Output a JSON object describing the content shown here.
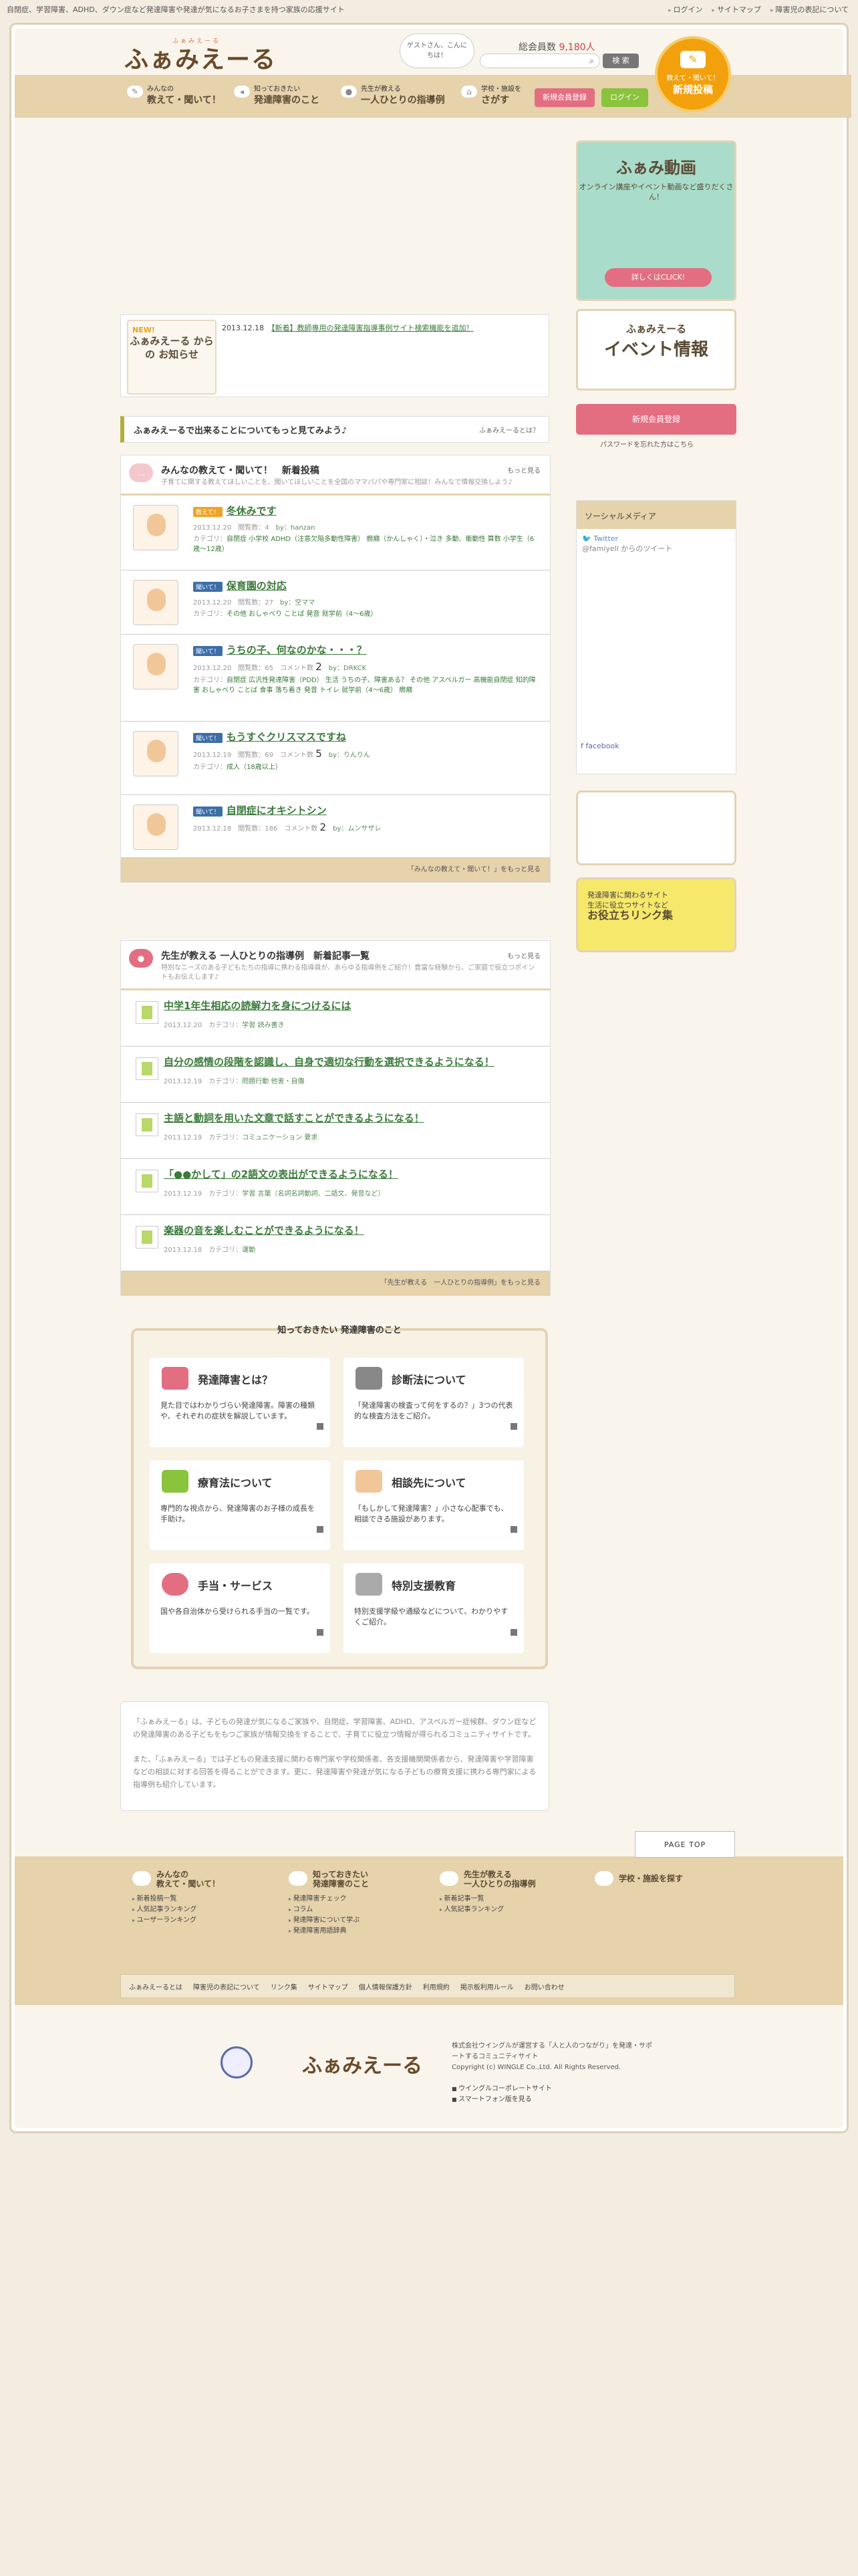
{
  "topbar": {
    "description": "自閉症、学習障害、ADHD、ダウン症など発達障害や発達が気になるお子さまを持つ家族の応援サイト",
    "links": [
      "ログイン",
      "サイトマップ",
      "障害児の表記について"
    ]
  },
  "header": {
    "logo": "ふぁみえーる",
    "logo_kana": "ふぁみえーる",
    "guest_text": "ゲストさん、こんにちは！",
    "member_label": "総会員数",
    "member_count": "9,180人",
    "search_button": "検 索",
    "newpost_small": "教えて・聞いて！",
    "newpost_large": "新規投稿"
  },
  "nav": {
    "items": [
      {
        "l1": "みんなの",
        "l2": "教えて・聞いて！"
      },
      {
        "l1": "知っておきたい",
        "l2": "発達障害のこと"
      },
      {
        "l1": "先生が教える",
        "l2": "一人ひとりの指導例"
      },
      {
        "l1": "学校・施設を",
        "l2": "さがす"
      }
    ],
    "register": "新規会員登録",
    "login": "ログイン"
  },
  "news": {
    "badge_new": "NEW!",
    "badge_title": "ふぁみえーる からの お知らせ",
    "date": "2013.12.18",
    "text": "【新着】教師専用の発達障害指導事例サイト検索機能を追加！"
  },
  "infobar": {
    "text": "ふぁみえーるで出来ることについてもっと見てみよう♪",
    "right": "ふぁみえーるとは？"
  },
  "qa": {
    "title": "みんなの教えて・聞いて！　新着投稿",
    "more": "もっと見る",
    "desc": "子育てに関する教えてほしいことを、聞いてほしいことを全国のママパパや専門家に相談！みんなで情報交換しよう♪",
    "footer": "「みんなの教えて・聞いて！」をもっと見る",
    "posts": [
      {
        "tag": "教えて！",
        "title": "冬休みです",
        "date": "2013.12.20",
        "views": "閲覧数：4",
        "by": "by：hanzan",
        "cat": "カテゴリ：",
        "cats": "自閉症 小学校 ADHD（注意欠陥多動性障害） 癇癪（かんしゃく）・泣き 多動、衝動性 算数 小学生（6歳〜12歳）",
        "comments": ""
      },
      {
        "tag": "聞いて！",
        "title": "保育園の対応",
        "date": "2013.12.20",
        "views": "閲覧数：27",
        "by": "by：空ママ",
        "cat": "カテゴリ：",
        "cats": "その他 おしゃべり ことば 発音 就学前（4〜6歳）",
        "comments": ""
      },
      {
        "tag": "聞いて！",
        "title": "うちの子、何なのかな・・・？",
        "date": "2013.12.20",
        "views": "閲覧数：65",
        "by": "by：DRKCK",
        "cat": "カテゴリ：",
        "cats": "自閉症 広汎性発達障害（PDD） 生活 うちの子、障害ある？ その他 アスペルガー 高機能自閉症 知的障害 おしゃべり ことば 食事 落ち着き 発音 トイレ 就学前（4〜6歳） 癇癪",
        "comments": "2"
      },
      {
        "tag": "聞いて！",
        "title": "もうすぐクリスマスですね",
        "date": "2013.12.19",
        "views": "閲覧数：69",
        "by": "by：りんりん",
        "cat": "カテゴリ：",
        "cats": "成人（18歳以上）",
        "comments": "5"
      },
      {
        "tag": "聞いて！",
        "title": "自閉症にオキシトシン",
        "date": "2013.12.18",
        "views": "閲覧数：186",
        "by": "by：ムンサザレ",
        "cat": "カテゴリ：",
        "cats": "",
        "comments": "2"
      }
    ]
  },
  "teacher": {
    "title": "先生が教える 一人ひとりの指導例　新着記事一覧",
    "more": "もっと見る",
    "desc": "特別なニーズのある子どもたちの指導に携わる指導員が、あらゆる指導例をご紹介！豊富な経験から、ご家庭で役立つポイントもお伝えします♪",
    "footer": "「先生が教える　一人ひとりの指導例」をもっと見る",
    "posts": [
      {
        "title": "中学1年生相応の読解力を身につけるには",
        "date": "2013.12.20",
        "cat": "学習 読み書き"
      },
      {
        "title": "自分の感情の段階を認識し、自身で適切な行動を選択できるようになる！",
        "date": "2013.12.19",
        "cat": "問題行動 他害・自傷"
      },
      {
        "title": "主語と動詞を用いた文章で話すことができるようになる！",
        "date": "2013.12.19",
        "cat": "コミュニケーション 要求"
      },
      {
        "title": "「●●かして」の2語文の表出ができるようになる！",
        "date": "2013.12.19",
        "cat": "学習 言葉（名詞名詞動詞、二語文、発音など）"
      },
      {
        "title": "楽器の音を楽しむことができるようになる！",
        "date": "2013.12.18",
        "cat": "運動"
      }
    ]
  },
  "hatsu": {
    "title": "知っておきたい 発達障害のこと",
    "cards": [
      {
        "h": "発達障害とは？",
        "p": "見た目ではわかりづらい発達障害。障害の種類や、それぞれの症状を解説しています。"
      },
      {
        "h": "診断法について",
        "p": "「発達障害の検査って何をするの？」3つの代表的な検査方法をご紹介。"
      },
      {
        "h": "療育法について",
        "p": "専門的な視点から、発達障害のお子様の成長を手助け。"
      },
      {
        "h": "相談先について",
        "p": "「もしかして発達障害？」小さな心配事でも、相談できる施設があります。"
      },
      {
        "h": "手当・サービス",
        "p": "国や各自治体から受けられる手当の一覧です。"
      },
      {
        "h": "特別支援教育",
        "p": "特別支援学級や通級などについて、わかりやすくご紹介。"
      }
    ]
  },
  "about": {
    "p1": "「ふぁみえーる」は、子どもの発達が気になるご家族や、自閉症、学習障害、ADHD、アスペルガー症候群、ダウン症などの発達障害のある子どもをもつご家族が情報交換をすることで、子育てに役立つ情報が得られるコミュニティサイトです。",
    "p2": "また、「ふぁみえーる」では子どもの発達支援に関わる専門家や学校関係者、各支援機関関係者から、発達障害や学習障害などの相談に対する回答を得ることができます。更に、発達障害や発達が気になる子どもの療育支援に携わる専門家による指導例も紹介しています。"
  },
  "pagetop": "PAGE TOP",
  "footer": {
    "cols": [
      {
        "l1": "みんなの",
        "l2": "教えて・聞いて！",
        "items": [
          "新着投稿一覧",
          "人気記事ランキング",
          "ユーザーランキング"
        ]
      },
      {
        "l1": "知っておきたい",
        "l2": "発達障害のこと",
        "items": [
          "発達障害チェック",
          "コラム",
          "発達障害について学ぶ",
          "発達障害用語辞典"
        ]
      },
      {
        "l1": "先生が教える",
        "l2": "一人ひとりの指導例",
        "items": [
          "新着記事一覧",
          "人気記事ランキング"
        ]
      },
      {
        "l1": "",
        "l2": "学校・施設を探す",
        "items": []
      }
    ],
    "links": [
      "ふぁみえーるとは",
      "障害児の表記について",
      "リンク集",
      "サイトマップ",
      "個人情報保護方針",
      "利用規約",
      "掲示板利用ルール",
      "お問い合わせ"
    ],
    "logo": "ふぁみえーる",
    "company": "株式会社ウイングルが運営する「人と人のつながり」を発達・サポートするコミュニティサイト",
    "copyright": "Copyright (c) WINGLE Co.,Ltd. All Rights Reserved.",
    "ext": [
      "ウイングルコーポレートサイト",
      "スマートフォン版を見る"
    ]
  },
  "side": {
    "douga_title": "ふぁみ動画",
    "douga_sub": "オンライン講座やイベント動画など盛りだくさん！",
    "douga_btn": "詳しくはCLICK!",
    "event_a": "ふぁみえーる",
    "event_b": "イベント情報",
    "register": "新規会員登録",
    "forgot": "パスワードを忘れた方はこちら",
    "social_title": "ソーシャルメディア",
    "twitter": "Twitter",
    "twitter_from": "@famiyell からのツイート",
    "facebook": "facebook",
    "link_l1": "発達障害に関わるサイト",
    "link_l2": "生活に役立つサイトなど",
    "link_l3": "お役立ちリンク集"
  }
}
